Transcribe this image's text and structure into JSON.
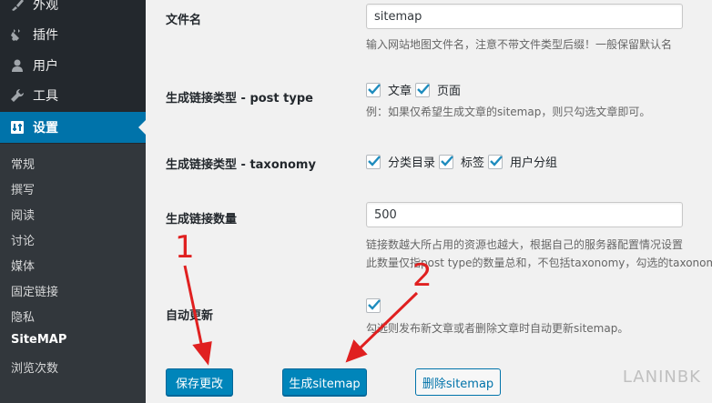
{
  "sidebar": {
    "menu": [
      {
        "label": "外观",
        "icon": "brush-icon"
      },
      {
        "label": "插件",
        "icon": "plug-icon"
      },
      {
        "label": "用户",
        "icon": "user-icon"
      },
      {
        "label": "工具",
        "icon": "wrench-icon"
      },
      {
        "label": "设置",
        "icon": "settings-icon",
        "current": true
      }
    ],
    "submenu": [
      "常规",
      "撰写",
      "阅读",
      "讨论",
      "媒体",
      "固定链接",
      "隐私",
      "SiteMAP",
      "浏览次数"
    ],
    "submenu_current": "SiteMAP"
  },
  "form": {
    "filename": {
      "label": "文件名",
      "value": "sitemap",
      "desc": "输入网站地图文件名，注意不带文件类型后缀！一般保留默认名"
    },
    "post_type": {
      "label": "生成链接类型 - post type",
      "options": [
        {
          "label": "文章",
          "checked": true
        },
        {
          "label": "页面",
          "checked": true
        }
      ],
      "desc": "例：如果仅希望生成文章的sitemap，则只勾选文章即可。"
    },
    "taxonomy": {
      "label": "生成链接类型 - taxonomy",
      "options": [
        {
          "label": "分类目录",
          "checked": true
        },
        {
          "label": "标签",
          "checked": true
        },
        {
          "label": "用户分组",
          "checked": true
        }
      ]
    },
    "count": {
      "label": "生成链接数量",
      "value": "500",
      "desc1": "链接数越大所占用的资源也越大，根据自己的服务器配置情况设置",
      "desc2": "此数量仅指post type的数量总和，不包括taxonomy，勾选的taxonomy"
    },
    "auto_update": {
      "label": "自动更新",
      "checked": true,
      "desc": "勾选则发布新文章或者删除文章时自动更新sitemap。"
    }
  },
  "buttons": {
    "save": "保存更改",
    "generate": "生成sitemap",
    "delete": "删除sitemap"
  },
  "annotations": {
    "one": "1",
    "two": "2",
    "color": "#e02020"
  },
  "watermark": "LANINBK",
  "colors": {
    "sidebar_bg": "#23282d",
    "active_menu": "#0073aa",
    "primary_button": "#0085ba"
  }
}
